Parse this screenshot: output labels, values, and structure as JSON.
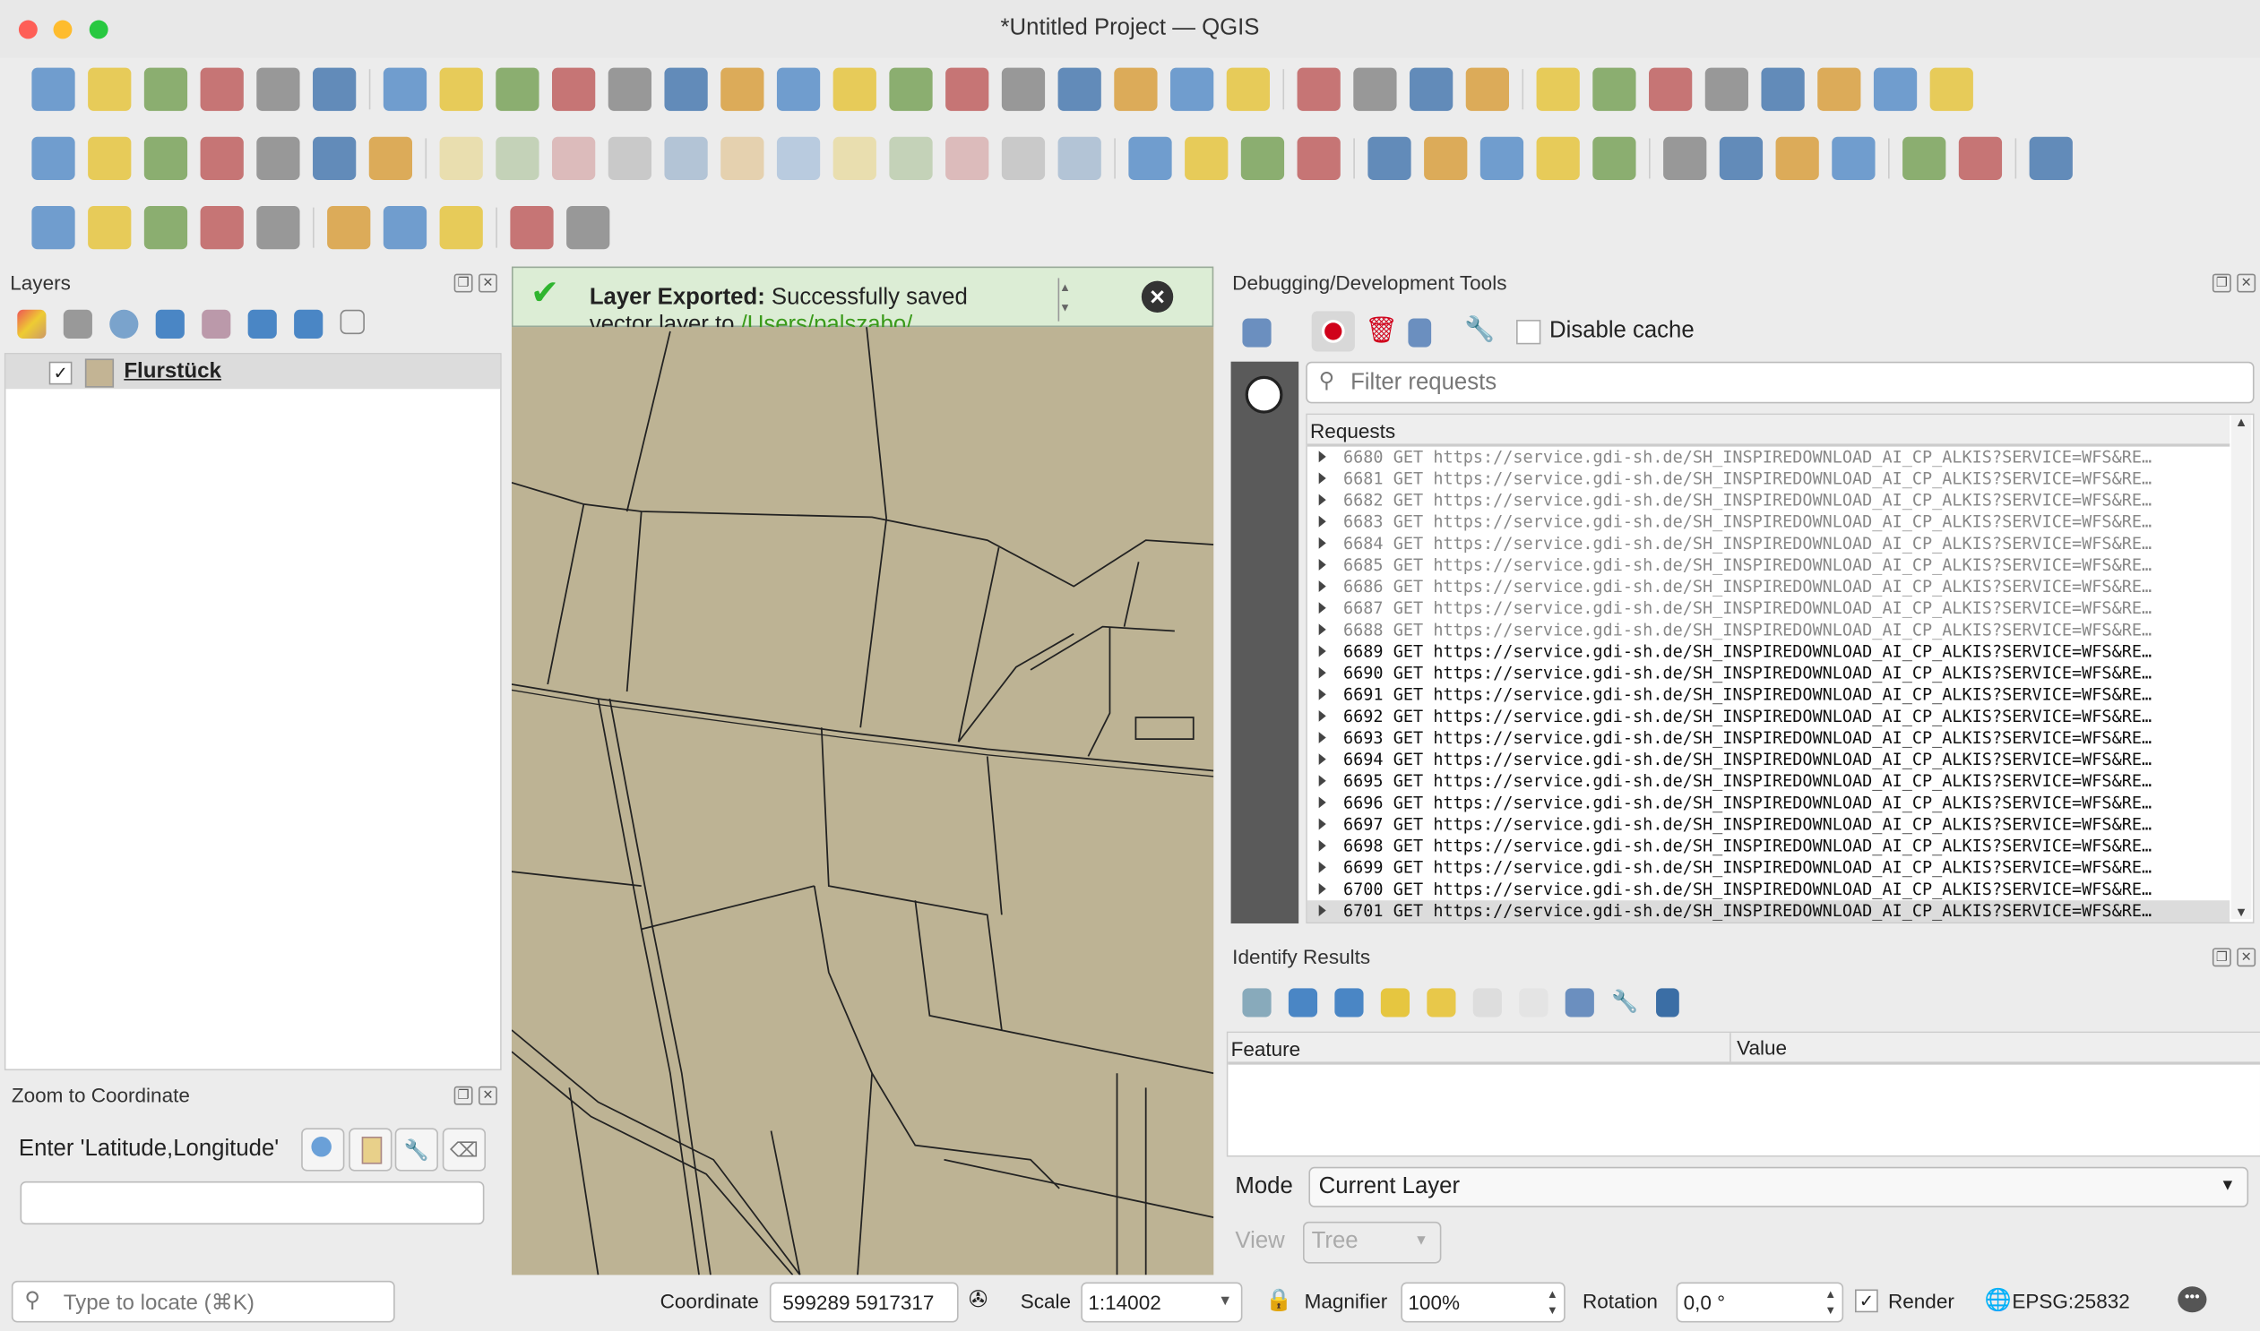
{
  "window": {
    "title": "*Untitled Project — QGIS"
  },
  "toolbars": {
    "row1": [
      "new-project-icon",
      "open-project-icon",
      "save-project-icon",
      "new-print-layout-icon",
      "layout-manager-icon",
      "style-manager-icon",
      "|",
      "pan-icon",
      "pan-to-selection-icon",
      "zoom-in-icon",
      "zoom-out-icon",
      "zoom-full-icon",
      "zoom-to-selection-icon",
      "zoom-to-layer-icon",
      "zoom-native-icon",
      "zoom-last-icon",
      "zoom-next-icon",
      "new-bookmark-icon",
      "show-bookmarks-icon",
      "spatial-bookmark-icon",
      "new-map-view-icon",
      "temporal-controller-icon",
      "refresh-icon",
      "|",
      "select-features-icon",
      "select-by-value-icon",
      "deselect-icon",
      "select-location-icon",
      "|",
      "identify-icon",
      "attribute-table-icon",
      "processing-toolbox-icon",
      "statistics-sum-icon",
      "open-table-icon",
      "measure-icon",
      "map-tips-icon",
      "options-icon"
    ],
    "row2": [
      "data-source-manager-icon",
      "new-geopackage-layer-icon",
      "digitize-vertex-icon",
      "digitize-pen-icon",
      "new-virtual-layer-icon",
      "new-mesh-layer-icon",
      "vertex-tool-icon",
      "|",
      "edit-pencil-icon",
      "toggle-editing-icon",
      "save-edits-icon",
      "add-feature-icon",
      "vertex-editor-icon",
      "modify-attributes-icon",
      "delete-selected-icon",
      "cut-features-icon",
      "copy-features-icon",
      "paste-features-icon",
      "undo-icon",
      "redo-icon",
      "|",
      "label-icon",
      "diagram-icon",
      "label-pin-icon",
      "label-highlight-icon",
      "|",
      "pin-label-icon",
      "show-hide-label-icon",
      "move-label-icon",
      "rotate-label-icon",
      "change-label-icon",
      "|",
      "metasearch-icon",
      "wfs-search-icon",
      "plugin-icon",
      "more-icon",
      "|",
      "python-console-icon",
      "more-icon",
      "|",
      "help-icon"
    ],
    "row3": [
      "new-point-icon",
      "pin-icon",
      "search-zoom-icon",
      "zoom-extent-icon",
      "capture-coordinate-icon",
      "|",
      "globe-icon",
      "xy-tool-icon",
      "wrench-icon",
      "|",
      "plugin-a-icon",
      "settings-gear-icon"
    ]
  },
  "layers_panel": {
    "title": "Layers",
    "layers": [
      {
        "name": "Flurstück",
        "checked": true,
        "swatch": "#c3b494"
      }
    ]
  },
  "message_bar": {
    "bold": "Layer Exported:",
    "text": " Successfully saved",
    "line2": "vector layer to ",
    "link": "/Users/palszabo/"
  },
  "zoom_to_coordinate": {
    "title": "Zoom to Coordinate",
    "label": "Enter 'Latitude,Longitude'",
    "value": ""
  },
  "locator": {
    "placeholder": "Type to locate (⌘K)"
  },
  "debug_panel": {
    "title": "Debugging/Development Tools",
    "disable_cache_label": "Disable cache",
    "filter_placeholder": "Filter requests",
    "requests_header": "Requests",
    "requests": [
      {
        "id": "6680",
        "method": "GET",
        "url": "https://service.gdi-sh.de/SH_INSPIREDOWNLOAD_AI_CP_ALKIS?SERVICE=WFS&RE…",
        "done": true
      },
      {
        "id": "6681",
        "method": "GET",
        "url": "https://service.gdi-sh.de/SH_INSPIREDOWNLOAD_AI_CP_ALKIS?SERVICE=WFS&RE…",
        "done": true
      },
      {
        "id": "6682",
        "method": "GET",
        "url": "https://service.gdi-sh.de/SH_INSPIREDOWNLOAD_AI_CP_ALKIS?SERVICE=WFS&RE…",
        "done": true
      },
      {
        "id": "6683",
        "method": "GET",
        "url": "https://service.gdi-sh.de/SH_INSPIREDOWNLOAD_AI_CP_ALKIS?SERVICE=WFS&RE…",
        "done": true
      },
      {
        "id": "6684",
        "method": "GET",
        "url": "https://service.gdi-sh.de/SH_INSPIREDOWNLOAD_AI_CP_ALKIS?SERVICE=WFS&RE…",
        "done": true
      },
      {
        "id": "6685",
        "method": "GET",
        "url": "https://service.gdi-sh.de/SH_INSPIREDOWNLOAD_AI_CP_ALKIS?SERVICE=WFS&RE…",
        "done": true
      },
      {
        "id": "6686",
        "method": "GET",
        "url": "https://service.gdi-sh.de/SH_INSPIREDOWNLOAD_AI_CP_ALKIS?SERVICE=WFS&RE…",
        "done": true
      },
      {
        "id": "6687",
        "method": "GET",
        "url": "https://service.gdi-sh.de/SH_INSPIREDOWNLOAD_AI_CP_ALKIS?SERVICE=WFS&RE…",
        "done": true
      },
      {
        "id": "6688",
        "method": "GET",
        "url": "https://service.gdi-sh.de/SH_INSPIREDOWNLOAD_AI_CP_ALKIS?SERVICE=WFS&RE…",
        "done": true
      },
      {
        "id": "6689",
        "method": "GET",
        "url": "https://service.gdi-sh.de/SH_INSPIREDOWNLOAD_AI_CP_ALKIS?SERVICE=WFS&RE…",
        "done": false
      },
      {
        "id": "6690",
        "method": "GET",
        "url": "https://service.gdi-sh.de/SH_INSPIREDOWNLOAD_AI_CP_ALKIS?SERVICE=WFS&RE…",
        "done": false
      },
      {
        "id": "6691",
        "method": "GET",
        "url": "https://service.gdi-sh.de/SH_INSPIREDOWNLOAD_AI_CP_ALKIS?SERVICE=WFS&RE…",
        "done": false
      },
      {
        "id": "6692",
        "method": "GET",
        "url": "https://service.gdi-sh.de/SH_INSPIREDOWNLOAD_AI_CP_ALKIS?SERVICE=WFS&RE…",
        "done": false
      },
      {
        "id": "6693",
        "method": "GET",
        "url": "https://service.gdi-sh.de/SH_INSPIREDOWNLOAD_AI_CP_ALKIS?SERVICE=WFS&RE…",
        "done": false
      },
      {
        "id": "6694",
        "method": "GET",
        "url": "https://service.gdi-sh.de/SH_INSPIREDOWNLOAD_AI_CP_ALKIS?SERVICE=WFS&RE…",
        "done": false
      },
      {
        "id": "6695",
        "method": "GET",
        "url": "https://service.gdi-sh.de/SH_INSPIREDOWNLOAD_AI_CP_ALKIS?SERVICE=WFS&RE…",
        "done": false
      },
      {
        "id": "6696",
        "method": "GET",
        "url": "https://service.gdi-sh.de/SH_INSPIREDOWNLOAD_AI_CP_ALKIS?SERVICE=WFS&RE…",
        "done": false
      },
      {
        "id": "6697",
        "method": "GET",
        "url": "https://service.gdi-sh.de/SH_INSPIREDOWNLOAD_AI_CP_ALKIS?SERVICE=WFS&RE…",
        "done": false
      },
      {
        "id": "6698",
        "method": "GET",
        "url": "https://service.gdi-sh.de/SH_INSPIREDOWNLOAD_AI_CP_ALKIS?SERVICE=WFS&RE…",
        "done": false
      },
      {
        "id": "6699",
        "method": "GET",
        "url": "https://service.gdi-sh.de/SH_INSPIREDOWNLOAD_AI_CP_ALKIS?SERVICE=WFS&RE…",
        "done": false
      },
      {
        "id": "6700",
        "method": "GET",
        "url": "https://service.gdi-sh.de/SH_INSPIREDOWNLOAD_AI_CP_ALKIS?SERVICE=WFS&RE…",
        "done": false
      },
      {
        "id": "6701",
        "method": "GET",
        "url": "https://service.gdi-sh.de/SH_INSPIREDOWNLOAD_AI_CP_ALKIS?SERVICE=WFS&RE…",
        "done": false,
        "selected": true
      }
    ]
  },
  "identify_panel": {
    "title": "Identify Results",
    "col_feature": "Feature",
    "col_value": "Value",
    "mode_label": "Mode",
    "mode_value": "Current Layer",
    "view_label": "View",
    "view_value": "Tree"
  },
  "statusbar": {
    "coordinate_label": "Coordinate",
    "coordinate_value": "599289 5917317",
    "scale_label": "Scale",
    "scale_value": "1:14002",
    "magnifier_label": "Magnifier",
    "magnifier_value": "100%",
    "rotation_label": "Rotation",
    "rotation_value": "0,0 °",
    "render_label": "Render",
    "render_checked": true,
    "crs": "EPSG:25832"
  },
  "colors": {
    "map_fill": "#bdb394",
    "message_bg": "#dcedd5",
    "link": "#3a9a1a",
    "record": "#d0021b"
  }
}
